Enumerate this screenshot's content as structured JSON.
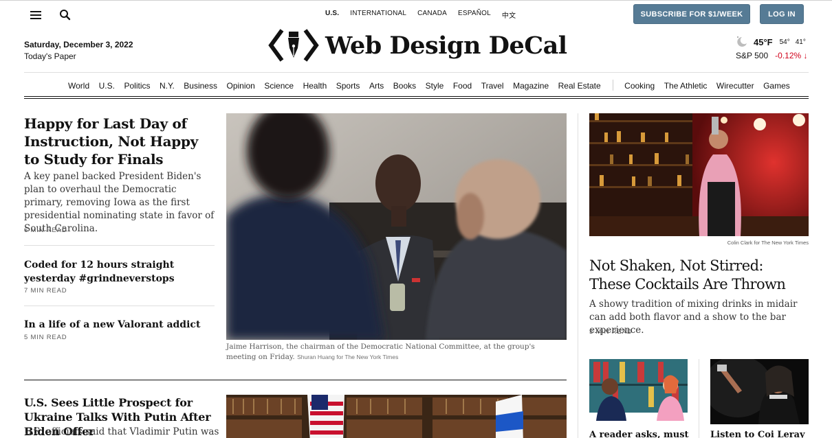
{
  "header": {
    "editions": [
      "U.S.",
      "INTERNATIONAL",
      "CANADA",
      "ESPAÑOL",
      "中文"
    ],
    "subscribe_label": "SUBSCRIBE FOR $1/WEEK",
    "login_label": "LOG IN",
    "date": "Saturday, December 3, 2022",
    "todays_paper": "Today's Paper",
    "logo_text": "Web Design DeCal",
    "weather": {
      "temp": "45°F",
      "high": "54°",
      "low": "41°",
      "icon": "moon-cloud-icon"
    },
    "market": {
      "name": "S&P 500",
      "change": "-0.12%",
      "direction": "down",
      "change_color": "#d0021b"
    },
    "button_color": "#567b95"
  },
  "nav": {
    "sections": [
      "World",
      "U.S.",
      "Politics",
      "N.Y.",
      "Business",
      "Opinion",
      "Science",
      "Health",
      "Sports",
      "Arts",
      "Books",
      "Style",
      "Food",
      "Travel",
      "Magazine",
      "Real Estate"
    ],
    "extra": [
      "Cooking",
      "The Athletic",
      "Wirecutter",
      "Games"
    ]
  },
  "left": {
    "a1": {
      "title": "Happy for Last Day of Instruction, Not Happy to Study for Finals",
      "summary": "A key panel backed President Biden's plan to overhaul the Democratic primary, removing Iowa as the first presidential nominating state in favor of South Carolina.",
      "readtime": "6 MIN READ"
    },
    "a2": {
      "title": "Coded for 12 hours straight yesterday #grindneverstops",
      "readtime": "7 MIN READ"
    },
    "a3": {
      "title": "In a life of a new Valorant addict",
      "readtime": "5 MIN READ"
    }
  },
  "main": {
    "caption": "Jaime Harrison, the chairman of the Democratic National Committee, at the group's meeting on Friday.",
    "credit": "Shuran Huang for The New York Times"
  },
  "bottom": {
    "title": "U.S. Sees Little Prospect for Ukraine Talks With Putin After Biden Offer",
    "summary": "U.S. officials said that Vladimir Putin was"
  },
  "right": {
    "credit": "Colin Clark for The New York Times",
    "title": "Not Shaken, Not Stirred: These Cocktails Are Thrown",
    "summary": "A showy tradition of mixing drinks in midair can add both flavor and a show to the bar experience.",
    "readtime": "3 MIN READ",
    "small1_title": "A reader asks, must",
    "small2_title": "Listen to Coi Leray"
  }
}
